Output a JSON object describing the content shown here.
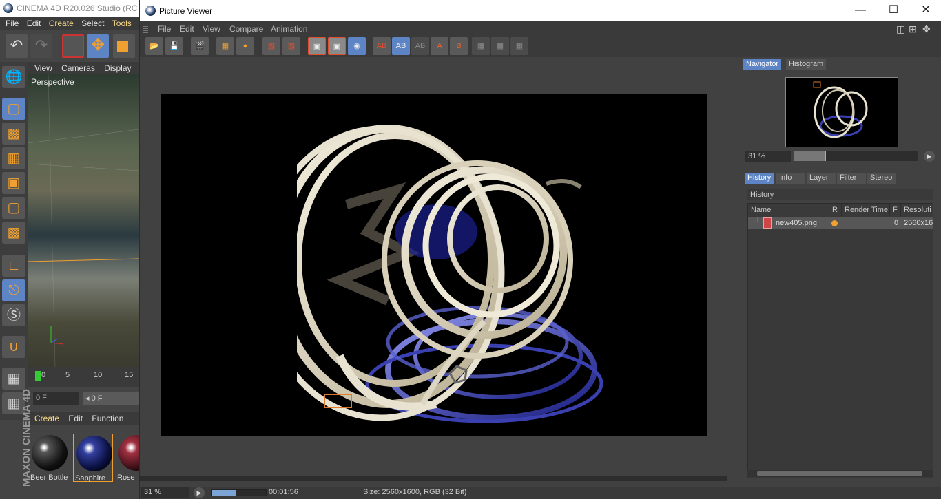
{
  "c4d": {
    "title": "CINEMA 4D R20.026 Studio (RC -",
    "menu": [
      "File",
      "Edit",
      "Create",
      "Select",
      "Tools"
    ],
    "viewport_menu": [
      "View",
      "Cameras",
      "Display"
    ],
    "viewport_label": "Perspective",
    "timeline_ticks": [
      "0",
      "5",
      "10",
      "15"
    ],
    "frame_field": "0 F",
    "frame_field2": "◂ 0 F",
    "material_menu": [
      "Create",
      "Edit",
      "Function"
    ],
    "materials": [
      "Beer Bottle",
      "Sapphire",
      "Rose"
    ],
    "brand": "MAXON CINEMA 4D"
  },
  "viewer": {
    "title": "Picture Viewer",
    "window_controls": [
      "—",
      "☐",
      "✕"
    ],
    "menu": [
      "File",
      "Edit",
      "View",
      "Compare",
      "Animation"
    ],
    "toolbar_ab": [
      "AB",
      "AB",
      "AB",
      "A",
      "B"
    ],
    "status": {
      "zoom": "31 %",
      "progress": 0.45,
      "time": "00:01:56",
      "size": "Size: 2560x1600, RGB (32 Bit)"
    }
  },
  "panel": {
    "top_tabs": [
      "Navigator",
      "Histogram"
    ],
    "nav_zoom": "31 %",
    "nav_zoom_level": 0.31,
    "tabs": [
      "History",
      "Info",
      "Layer",
      "Filter",
      "Stereo"
    ],
    "history_heading": "History",
    "columns": [
      "Name",
      "R",
      "Render Time",
      "F",
      "Resoluti"
    ],
    "rows": [
      {
        "name": "new405.png",
        "frame": "0",
        "resolution": "2560x16"
      }
    ]
  },
  "colors": {
    "accent_blue": "#5d84c4",
    "accent_orange": "#f0a030",
    "status_dot": "#f0a030"
  }
}
